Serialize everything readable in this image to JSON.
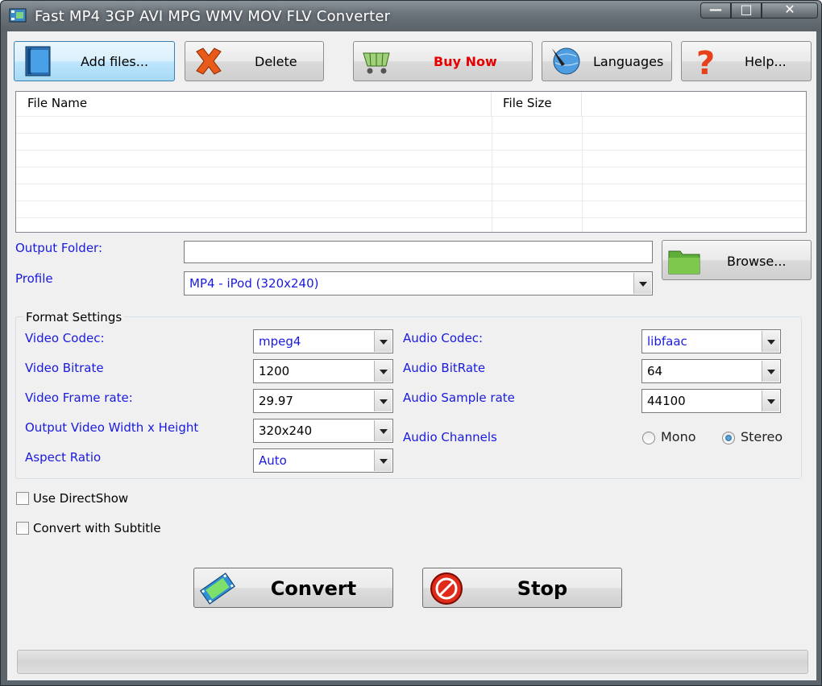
{
  "window": {
    "title": "Fast MP4 3GP AVI MPG WMV MOV FLV Converter"
  },
  "toolbar": {
    "add_files": "Add files...",
    "delete": "Delete",
    "buy_now": "Buy Now",
    "languages": "Languages",
    "help": "Help..."
  },
  "file_list": {
    "col_name": "File Name",
    "col_size": "File Size"
  },
  "output": {
    "folder_label": "Output Folder:",
    "folder_value": "",
    "browse": "Browse..."
  },
  "profile": {
    "label": "Profile",
    "value": "MP4 - iPod (320x240)"
  },
  "format": {
    "title": "Format Settings",
    "video_codec_label": "Video Codec:",
    "video_codec": "mpeg4",
    "video_bitrate_label": "Video Bitrate",
    "video_bitrate": "1200",
    "frame_rate_label": "Video Frame rate:",
    "frame_rate": "29.97",
    "size_label": "Output Video Width x Height",
    "size": "320x240",
    "aspect_label": "Aspect Ratio",
    "aspect": "Auto",
    "audio_codec_label": "Audio Codec:",
    "audio_codec": "libfaac",
    "audio_bitrate_label": "Audio BitRate",
    "audio_bitrate": "64",
    "sample_rate_label": "Audio Sample rate",
    "sample_rate": "44100",
    "channels_label": "Audio Channels",
    "mono": "Mono",
    "stereo": "Stereo"
  },
  "options": {
    "directshow": "Use DirectShow",
    "subtitle": "Convert with Subtitle"
  },
  "actions": {
    "convert": "Convert",
    "stop": "Stop"
  },
  "colors": {
    "label_blue": "#1a1adf",
    "buy_now_red": "#e60000",
    "face": "#f0f0f0"
  }
}
